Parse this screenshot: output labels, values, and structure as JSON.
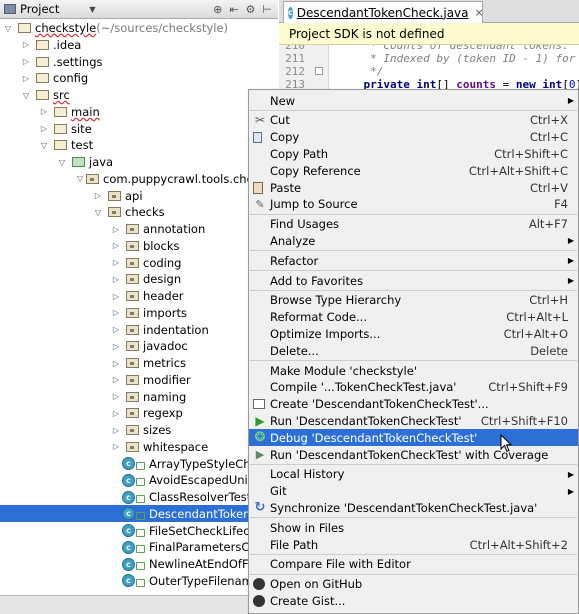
{
  "project_panel": {
    "title": "Project",
    "tree": [
      {
        "label": "checkstyle",
        "suffix": " (~/sources/checkstyle)",
        "arrow": "▽",
        "indent": 0,
        "type": "module",
        "squiggle": true
      },
      {
        "label": ".idea",
        "arrow": "▷",
        "indent": 1,
        "type": "folder"
      },
      {
        "label": ".settings",
        "arrow": "▷",
        "indent": 1,
        "type": "folder"
      },
      {
        "label": "config",
        "arrow": "▷",
        "indent": 1,
        "type": "folder"
      },
      {
        "label": "src",
        "arrow": "▽",
        "indent": 1,
        "type": "folder",
        "squiggle": true
      },
      {
        "label": "main",
        "arrow": "▷",
        "indent": 2,
        "type": "folder",
        "squiggle": true
      },
      {
        "label": "site",
        "arrow": "▷",
        "indent": 2,
        "type": "folder"
      },
      {
        "label": "test",
        "arrow": "▽",
        "indent": 2,
        "type": "folder"
      },
      {
        "label": "java",
        "arrow": "▽",
        "indent": 3,
        "type": "test"
      },
      {
        "label": "com.puppycrawl.tools.checkstyle",
        "arrow": "▽",
        "indent": 4,
        "type": "package"
      },
      {
        "label": "api",
        "arrow": "▷",
        "indent": 5,
        "type": "package"
      },
      {
        "label": "checks",
        "arrow": "▽",
        "indent": 5,
        "type": "package"
      },
      {
        "label": "annotation",
        "arrow": "▷",
        "indent": 6,
        "type": "package"
      },
      {
        "label": "blocks",
        "arrow": "▷",
        "indent": 6,
        "type": "package"
      },
      {
        "label": "coding",
        "arrow": "▷",
        "indent": 6,
        "type": "package"
      },
      {
        "label": "design",
        "arrow": "▷",
        "indent": 6,
        "type": "package"
      },
      {
        "label": "header",
        "arrow": "▷",
        "indent": 6,
        "type": "package"
      },
      {
        "label": "imports",
        "arrow": "▷",
        "indent": 6,
        "type": "package"
      },
      {
        "label": "indentation",
        "arrow": "▷",
        "indent": 6,
        "type": "package"
      },
      {
        "label": "javadoc",
        "arrow": "▷",
        "indent": 6,
        "type": "package"
      },
      {
        "label": "metrics",
        "arrow": "▷",
        "indent": 6,
        "type": "package"
      },
      {
        "label": "modifier",
        "arrow": "▷",
        "indent": 6,
        "type": "package"
      },
      {
        "label": "naming",
        "arrow": "▷",
        "indent": 6,
        "type": "package"
      },
      {
        "label": "regexp",
        "arrow": "▷",
        "indent": 6,
        "type": "package"
      },
      {
        "label": "sizes",
        "arrow": "▷",
        "indent": 6,
        "type": "package"
      },
      {
        "label": "whitespace",
        "arrow": "▷",
        "indent": 6,
        "type": "package"
      },
      {
        "label": "ArrayTypeStyleCheckTest",
        "arrow": "",
        "indent": 6,
        "type": "class"
      },
      {
        "label": "AvoidEscapedUnicodeCharactersCheckTest",
        "arrow": "",
        "indent": 6,
        "type": "class"
      },
      {
        "label": "ClassResolverTest",
        "arrow": "",
        "indent": 6,
        "type": "class"
      },
      {
        "label": "DescendantTokenCheckTest",
        "arrow": "",
        "indent": 6,
        "type": "class",
        "selected": true
      },
      {
        "label": "FileSetCheckLifecycleTest",
        "arrow": "",
        "indent": 6,
        "type": "class"
      },
      {
        "label": "FinalParametersCheckTest",
        "arrow": "",
        "indent": 6,
        "type": "class"
      },
      {
        "label": "NewlineAtEndOfFileCheckTest",
        "arrow": "",
        "indent": 6,
        "type": "class"
      },
      {
        "label": "OuterTypeFilenameCheckTest",
        "arrow": "",
        "indent": 6,
        "type": "class"
      }
    ]
  },
  "editor": {
    "tab_label": "DescendantTokenCheck.java",
    "tab_close": "×",
    "banner": "Project SDK is not defined",
    "lines": [
      {
        "num": "210",
        "text": "     * Counts of descendant tokens."
      },
      {
        "num": "211",
        "text": "     * Indexed by (token ID - 1) for pe"
      },
      {
        "num": "212",
        "text": "     */"
      },
      {
        "num": "213",
        "text": "    private int[] counts = new int[0];"
      }
    ]
  },
  "context_menu": {
    "items": [
      {
        "label": "New",
        "submenu": true
      },
      {
        "sep": true
      },
      {
        "label": "Cut",
        "shortcut": "Ctrl+X",
        "icon": "cut"
      },
      {
        "label": "Copy",
        "shortcut": "Ctrl+C",
        "icon": "copy"
      },
      {
        "label": "Copy Path",
        "shortcut": "Ctrl+Shift+C"
      },
      {
        "label": "Copy Reference",
        "shortcut": "Ctrl+Alt+Shift+C"
      },
      {
        "label": "Paste",
        "shortcut": "Ctrl+V",
        "icon": "paste"
      },
      {
        "label": "Jump to Source",
        "shortcut": "F4",
        "icon": "jump"
      },
      {
        "sep": true
      },
      {
        "label": "Find Usages",
        "shortcut": "Alt+F7"
      },
      {
        "label": "Analyze",
        "submenu": true
      },
      {
        "sep": true
      },
      {
        "label": "Refactor",
        "submenu": true
      },
      {
        "sep": true
      },
      {
        "label": "Add to Favorites",
        "submenu": true
      },
      {
        "sep": true
      },
      {
        "label": "Browse Type Hierarchy",
        "shortcut": "Ctrl+H"
      },
      {
        "label": "Reformat Code...",
        "shortcut": "Ctrl+Alt+L"
      },
      {
        "label": "Optimize Imports...",
        "shortcut": "Ctrl+Alt+O"
      },
      {
        "label": "Delete...",
        "shortcut": "Delete"
      },
      {
        "sep": true
      },
      {
        "label": "Make Module 'checkstyle'"
      },
      {
        "label": "Compile '...TokenCheckTest.java'",
        "shortcut": "Ctrl+Shift+F9"
      },
      {
        "label": "Create 'DescendantTokenCheckTest'...",
        "icon": "create"
      },
      {
        "label": "Run 'DescendantTokenCheckTest'",
        "shortcut": "Ctrl+Shift+F10",
        "icon": "run"
      },
      {
        "label": "Debug 'DescendantTokenCheckTest'",
        "icon": "debug",
        "highlight": true
      },
      {
        "label": "Run 'DescendantTokenCheckTest' with Coverage",
        "icon": "cov"
      },
      {
        "sep": true
      },
      {
        "label": "Local History",
        "submenu": true
      },
      {
        "label": "Git",
        "submenu": true
      },
      {
        "label": "Synchronize 'DescendantTokenCheckTest.java'",
        "icon": "sync"
      },
      {
        "sep": true
      },
      {
        "label": "Show in Files"
      },
      {
        "label": "File Path",
        "shortcut": "Ctrl+Alt+Shift+2"
      },
      {
        "sep": true
      },
      {
        "label": "Compare File with Editor"
      },
      {
        "sep": true
      },
      {
        "label": "Open on GitHub",
        "icon": "github"
      },
      {
        "label": "Create Gist...",
        "icon": "gist"
      }
    ]
  },
  "colors": {
    "selection": "#2c70d6",
    "menu_bg": "#f0f0f0",
    "banner_bg": "#fffbd0"
  }
}
